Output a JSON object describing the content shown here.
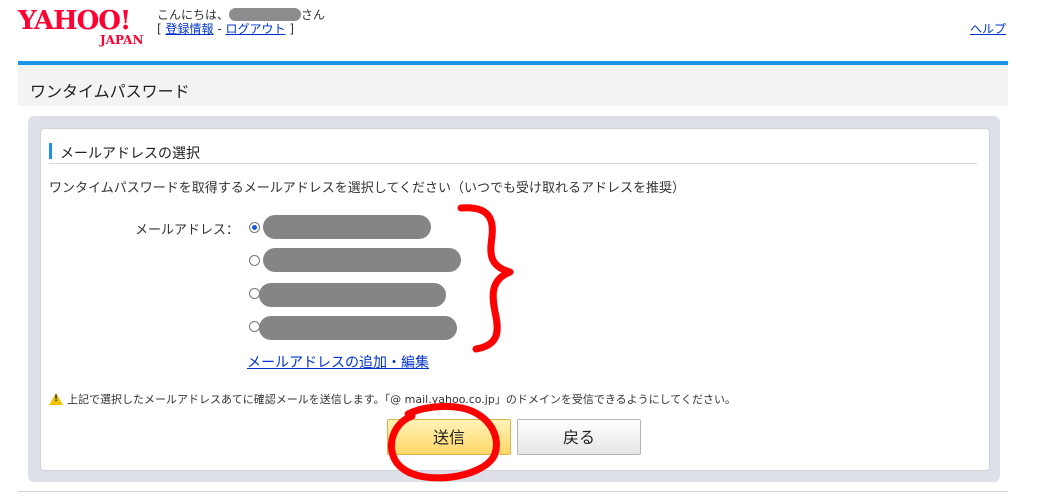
{
  "header": {
    "logo_text": "YAHOO!",
    "logo_sub": "JAPAN",
    "greeting_prefix": "こんにちは、",
    "greeting_suffix": "さん",
    "bracket_open": "[",
    "register_link": "登録情報",
    "separator": "-",
    "logout_link": "ログアウト",
    "bracket_close": "]",
    "help_link": "ヘルプ"
  },
  "page": {
    "title": "ワンタイムパスワード"
  },
  "section": {
    "title": "メールアドレスの選択",
    "description": "ワンタイムパスワードを取得するメールアドレスを選択してください（いつでも受け取れるアドレスを推奨）",
    "email_label": "メールアドレス：",
    "email_options": [
      {
        "selected": true
      },
      {
        "selected": false
      },
      {
        "selected": false
      },
      {
        "selected": false
      }
    ],
    "add_edit_link": "メールアドレスの追加・編集",
    "warning": "上記で選択したメールアドレスあてに確認メールを送信します。「@ mail.yahoo.co.jp」のドメインを受信できるようにしてください。"
  },
  "buttons": {
    "send": "送信",
    "back": "戻る"
  },
  "annotation": {
    "color": "#ff0000"
  }
}
